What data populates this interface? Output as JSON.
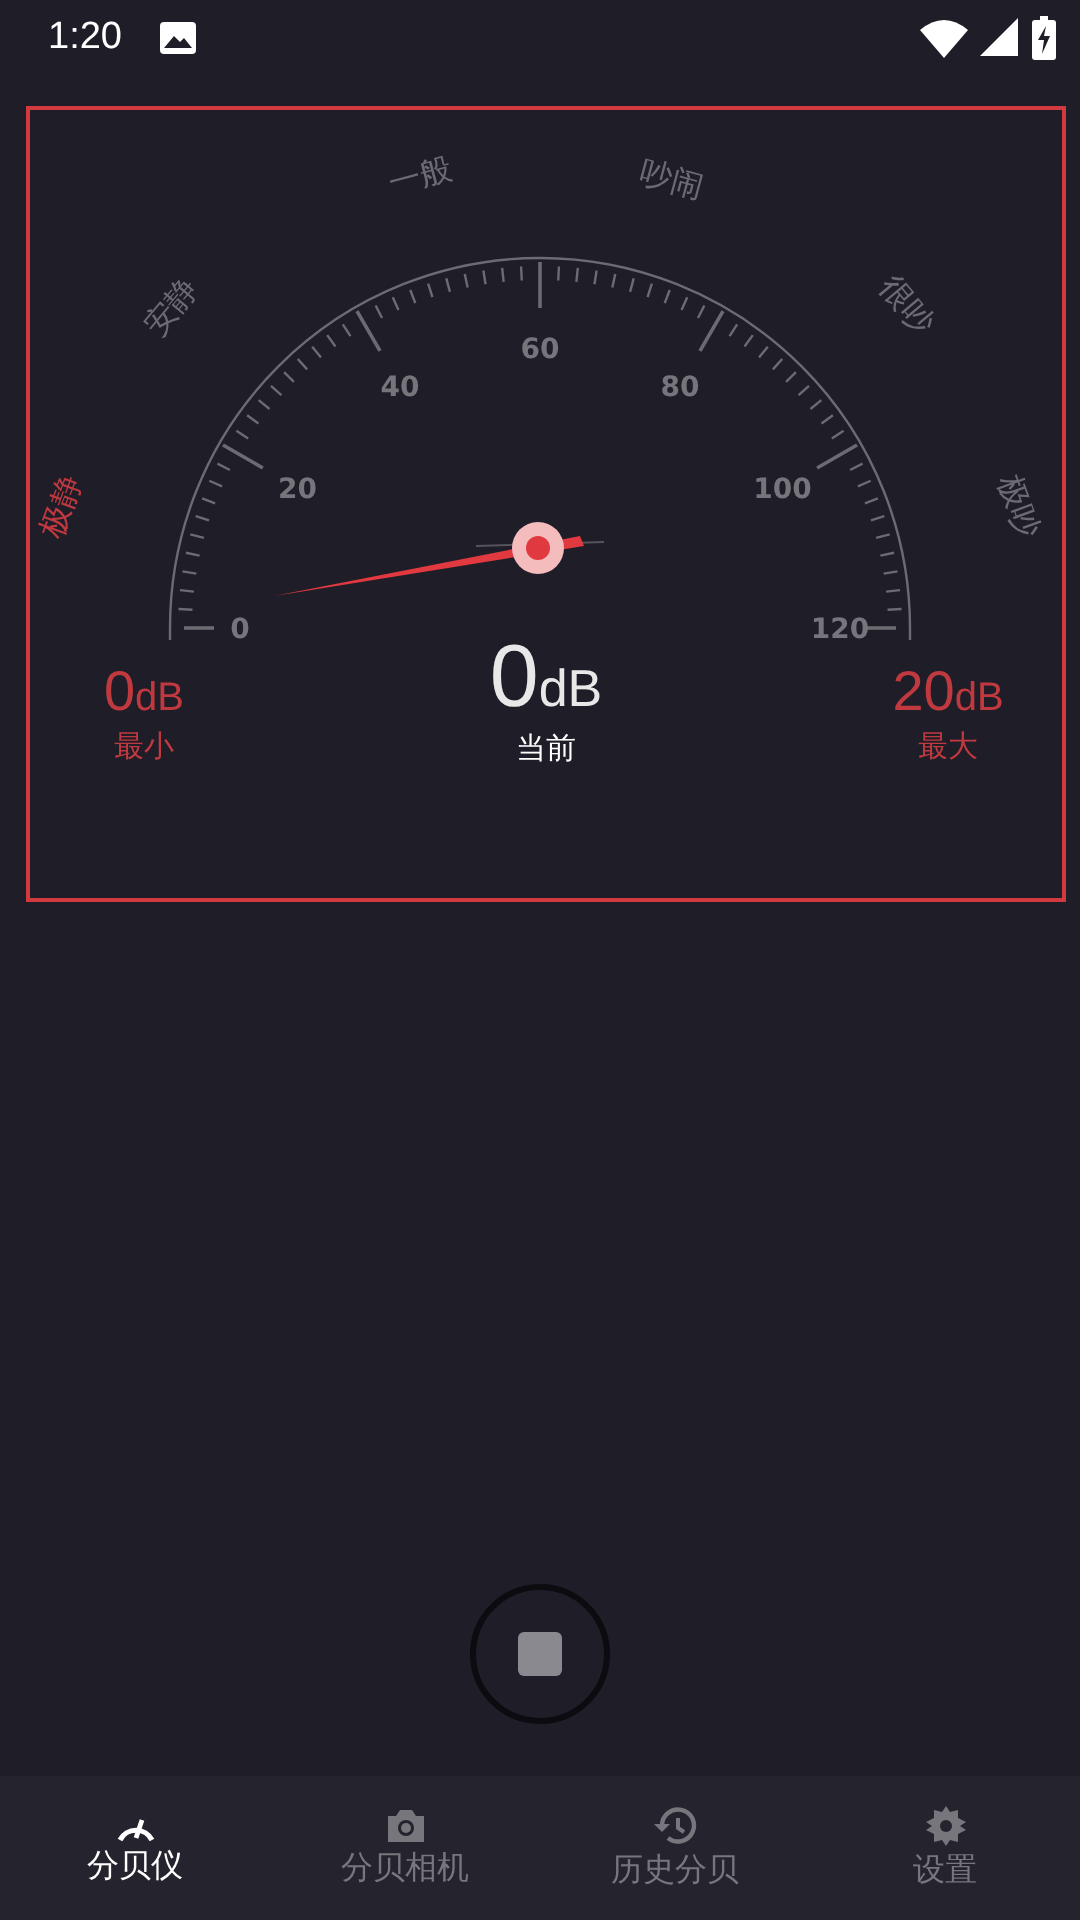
{
  "status_bar": {
    "time": "1:20"
  },
  "gauge": {
    "scale": [
      "0",
      "20",
      "40",
      "60",
      "80",
      "100",
      "120"
    ],
    "zones": [
      {
        "label": "极静",
        "selected": true
      },
      {
        "label": "安静",
        "selected": false
      },
      {
        "label": "一般",
        "selected": false
      },
      {
        "label": "吵闹",
        "selected": false
      },
      {
        "label": "很吵",
        "selected": false
      },
      {
        "label": "极吵",
        "selected": false
      }
    ]
  },
  "readings": [
    {
      "kind": "min",
      "value": "0",
      "unit": "dB",
      "label": "最小"
    },
    {
      "kind": "current",
      "value": "0",
      "unit": "dB",
      "label": "当前"
    },
    {
      "kind": "max",
      "value": "20",
      "unit": "dB",
      "label": "最大"
    }
  ],
  "tabs": [
    {
      "label": "分贝仪",
      "selected": true
    },
    {
      "label": "分贝相机",
      "selected": false
    },
    {
      "label": "历史分贝",
      "selected": false
    },
    {
      "label": "设置",
      "selected": false
    }
  ]
}
